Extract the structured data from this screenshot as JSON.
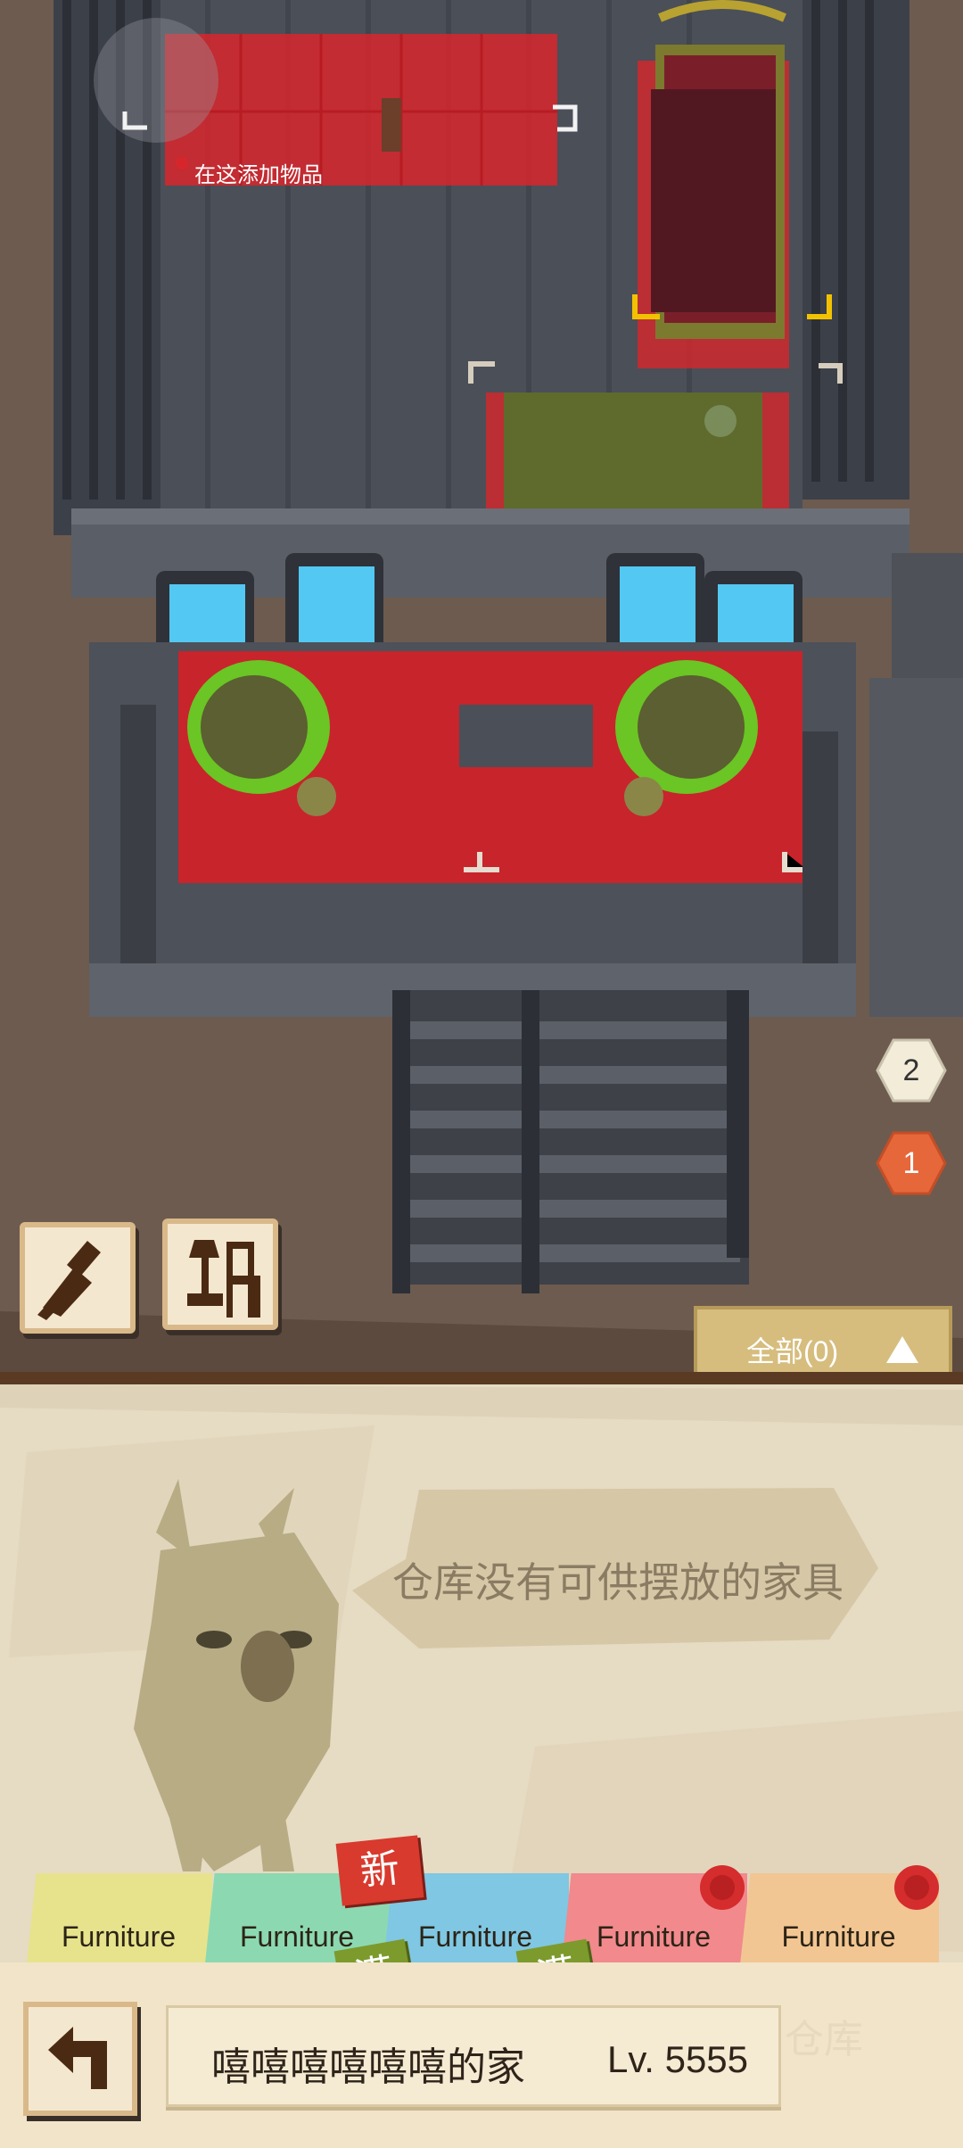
{
  "scene": {
    "placement_hint": "在这添加物品",
    "colors": {
      "ground": "#6b5a4e",
      "wall": "#4a4e57",
      "highlight_red": "#d7262b",
      "window": "#53c8f2",
      "carpet": "#c8242c"
    }
  },
  "tools": {
    "sweep_icon": "broom-icon",
    "furniture_icon": "lamp-chair-icon"
  },
  "badges": [
    {
      "value": "2"
    },
    {
      "value": "1"
    }
  ],
  "filter": {
    "label": "全部(0)",
    "icon": "triangle-up-icon"
  },
  "warehouse": {
    "empty_message": "仓库没有可供摆放的家具"
  },
  "tabs": [
    {
      "label": "Furniture",
      "color": "#e7e38d",
      "badge": ""
    },
    {
      "label": "Furniture",
      "color": "#8cd9b1",
      "badge": "新",
      "sub_badge": "满"
    },
    {
      "label": "Furniture",
      "color": "#7fc7e3",
      "sub_badge": "满"
    },
    {
      "label": "Furniture",
      "color": "#f1898d",
      "dot": true
    },
    {
      "label": "Furniture",
      "color": "#f2c693",
      "dot": true
    }
  ],
  "home": {
    "name": "嘻嘻嘻嘻嘻嘻的家",
    "level": "Lv. 5555",
    "back_icon": "back-arrow-icon",
    "watermark": "仓库"
  }
}
